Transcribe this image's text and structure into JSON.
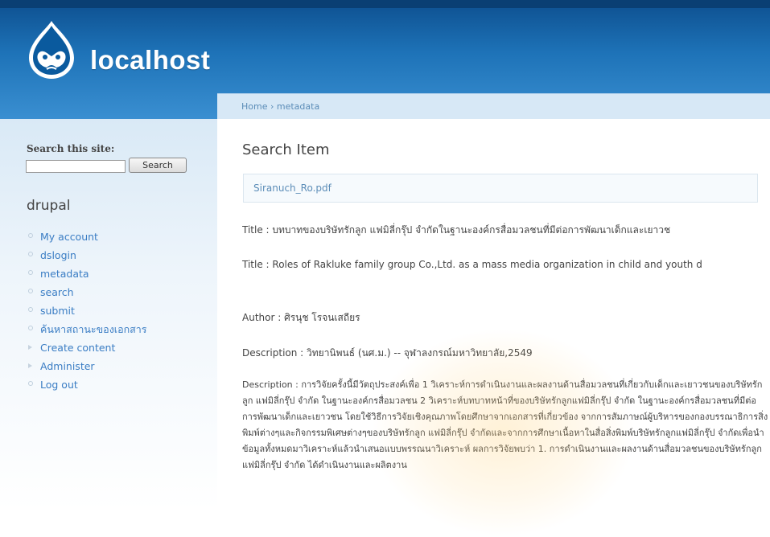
{
  "header": {
    "site_name": "localhost",
    "logo": "drupal-drop-logo"
  },
  "breadcrumb": {
    "home": "Home",
    "separator": "›",
    "current": "metadata"
  },
  "sidebar": {
    "search_label": "Search this site:",
    "search_value": "",
    "search_button": "Search",
    "nav_title": "drupal",
    "items": [
      {
        "label": "My account",
        "marker": "circle"
      },
      {
        "label": "dslogin",
        "marker": "circle"
      },
      {
        "label": "metadata",
        "marker": "circle"
      },
      {
        "label": "search",
        "marker": "circle"
      },
      {
        "label": "submit",
        "marker": "circle"
      },
      {
        "label": "ค้นหาสถานะของเอกสาร",
        "marker": "circle"
      },
      {
        "label": "Create content",
        "marker": "triangle"
      },
      {
        "label": "Administer",
        "marker": "triangle"
      },
      {
        "label": "Log out",
        "marker": "circle"
      }
    ]
  },
  "main": {
    "page_title": "Search Item",
    "filename": "Siranuch_Ro.pdf",
    "title_th": "Title : บทบาทของบริษัทรักลูก แฟมิลี่กรุ๊ป จำกัดในฐานะองค์กรสื่อมวลชนที่มีต่อการพัฒนาเด็กและเยาวช",
    "title_en": "Title : Roles of Rakluke family group Co.,Ltd. as a mass media organization in child and youth d",
    "author": "Author : ศิรนุช โรจนเสถียร",
    "description_1": "Description : วิทยานิพนธ์ (นศ.ม.) -- จุฬาลงกรณ์มหาวิทยาลัย,2549",
    "description_2": "Description : การวิจัยครั้งนี้มีวัตถุประสงค์เพื่อ 1 วิเคราะห์การดำเนินงานและผลงานด้านสื่อมวลชนที่เกี่ยวกับเด็กและเยาวชนของบริษัทรักลูก แฟมิลี่กรุ๊ป จำกัด ในฐานะองค์กรสื่อมวลชน 2 วิเคราะห์บทบาทหน้าที่ของบริษัทรักลูกแฟมิลี่กรุ๊ป จำกัด ในฐานะองค์กรสื่อมวลชนที่มีต่อการพัฒนาเด็กและเยาวชน โดยใช้วิธีการวิจัยเชิงคุณภาพโดยศึกษาจากเอกสารที่เกี่ยวข้อง จากการสัมภาษณ์ผู้บริหารของกองบรรณาธิการสิ่งพิมพ์ต่างๆและกิจกรรมพิเศษต่างๆของบริษัทรักลูก แฟมิลี่กรุ๊ป จำกัดและจากการศึกษาเนื้อหาในสื่อสิ่งพิมพ์บริษัทรักลูกแฟมิลี่กรุ๊ป จำกัดเพื่อนำข้อมูลทั้งหมดมาวิเคราะห์แล้วนำเสนอแบบพรรณนาวิเคราะห์ ผลการวิจัยพบว่า 1. การดำเนินงานและผลงานด้านสื่อมวลชนของบริษัทรักลูก แฟมิลี่กรุ๊ป จำกัด ได้ดำเนินงานและผลิตงาน"
  },
  "colors": {
    "header_dark": "#0d4f8f",
    "header_light": "#3a8fd1",
    "link": "#3a7dc4",
    "breadcrumb_bg": "#d7e8f6"
  }
}
